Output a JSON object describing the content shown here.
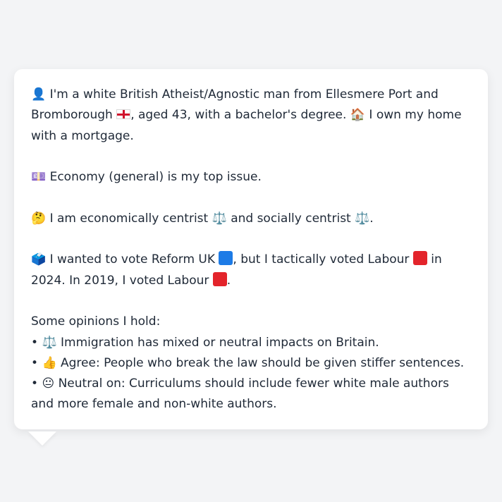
{
  "colors": {
    "card_background": "#ffffff",
    "page_background": "#f3f4f6",
    "text": "#1f2937",
    "reform_blue": "#1d7be6",
    "labour_red": "#e3242b"
  },
  "profile": {
    "intro_part1": "I'm a white British Atheist/Agnostic man from Ellesmere Port and Bromborough",
    "intro_part2": ", aged 43, with a bachelor's degree.",
    "intro_part3": "I own my home with a mortgage.",
    "person_icon": "👤",
    "house_icon": "🏠"
  },
  "issue": {
    "icon": "💷",
    "text": "Economy (general) is my top issue."
  },
  "ideology": {
    "icon": "🤔",
    "part1": "I am economically centrist",
    "part2": "and socially centrist",
    "scale_icon": "⚖️",
    "end": "."
  },
  "vote": {
    "icon": "🗳️",
    "part1": "I wanted to vote Reform UK",
    "part2": ", but I tactically voted Labour",
    "part3": "in 2024. In 2019, I voted Labour",
    "end": "."
  },
  "opinions": {
    "heading": "Some opinions I hold:",
    "bullet": "•",
    "items": [
      {
        "icon": "⚖️",
        "text": "Immigration has mixed or neutral impacts on Britain."
      },
      {
        "icon": "👍",
        "text": "Agree: People who break the law should be given stiffer sentences."
      },
      {
        "icon": "😐",
        "text": "Neutral on: Curriculums should include fewer white male authors and more female and non-white authors."
      }
    ]
  }
}
